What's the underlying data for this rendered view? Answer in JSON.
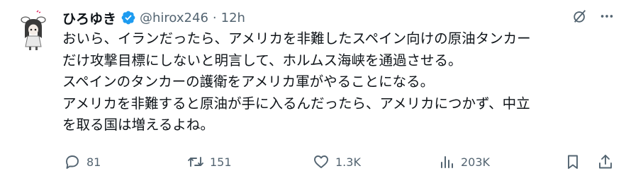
{
  "tweet": {
    "author": {
      "display_name": "ひろゆき",
      "handle": "@hirox246",
      "separator": "·",
      "time": "12h",
      "verified": true,
      "verified_color": "#1d9bf0"
    },
    "text_lines": [
      "おいら、イランだったら、アメリカを非難したスペイン向けの原油タンカー",
      "だけ攻撃目標にしないと明言して、ホルムス海峡を通過させる。",
      "スペインのタンカーの護衛をアメリカ軍がやることになる。",
      "アメリカを非難すると原油が手に入るんだったら、アメリカにつかず、中立",
      "を取る国は増えるよね。"
    ],
    "top_actions": {
      "grok_icon": "grok-slash-circle-icon",
      "more_icon": "more-dots-icon"
    },
    "actions": {
      "reply_count": "81",
      "repost_count": "151",
      "like_count": "1.3K",
      "views_count": "203K"
    },
    "colors": {
      "text": "#0f1419",
      "secondary": "#536471",
      "accent": "#1d9bf0"
    }
  }
}
